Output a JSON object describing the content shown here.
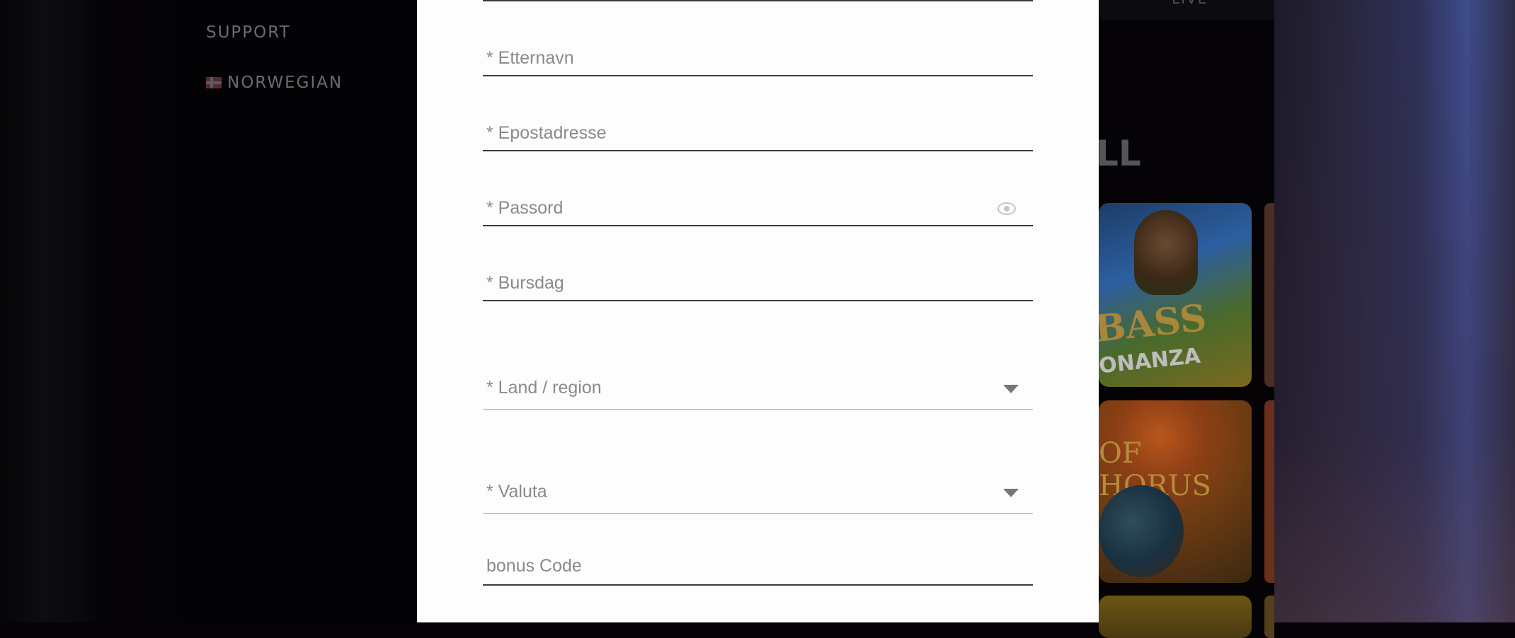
{
  "background": {
    "side_menu": {
      "items": [
        {
          "label": "SUPPORT"
        },
        {
          "label": "NORWEGIAN",
          "icon": "norway-flag-icon"
        }
      ]
    },
    "top_nav": {
      "label": "LIVE"
    },
    "section_heading_fragment": "LL",
    "game_tiles": [
      {
        "title": "BASS",
        "subtitle": "ONANZA"
      },
      {
        "title": "OF HORUS"
      }
    ]
  },
  "form": {
    "fields": {
      "last_name": {
        "label": "* Etternavn"
      },
      "email": {
        "label": "* Epostadresse"
      },
      "password": {
        "label": "* Passord",
        "icon": "eye-icon"
      },
      "birthday": {
        "label": "* Bursdag"
      },
      "country": {
        "label": "* Land / region",
        "icon": "chevron-down-icon"
      },
      "currency": {
        "label": "* Valuta",
        "icon": "chevron-down-icon"
      },
      "bonus_code": {
        "label": "bonus Code"
      }
    }
  }
}
